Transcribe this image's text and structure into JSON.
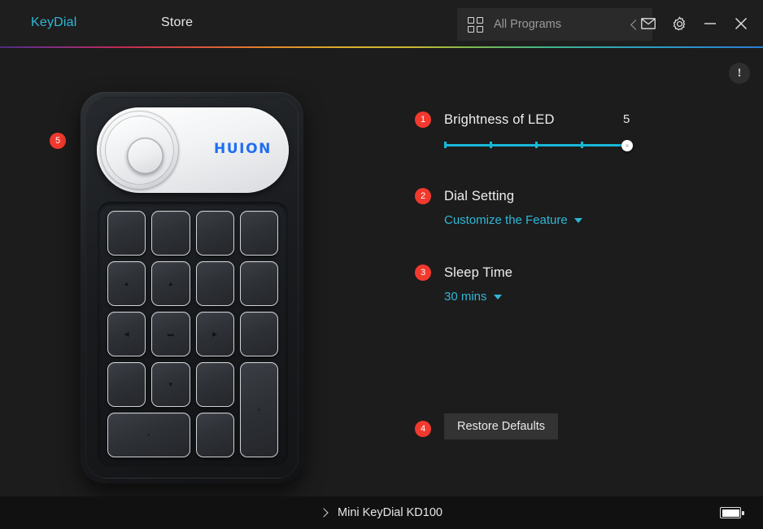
{
  "header": {
    "brand": "KeyDial",
    "store": "Store",
    "programs": {
      "label": "All Programs",
      "grid_icon": "grid-icon",
      "collapse_icon": "chevron-left-icon"
    },
    "window_controls": [
      {
        "name": "mail-icon",
        "label": "Mail"
      },
      {
        "name": "gear-icon",
        "label": "Settings"
      },
      {
        "name": "minimize-icon",
        "label": "Minimize"
      },
      {
        "name": "close-icon",
        "label": "Close"
      }
    ],
    "accent_gradient": "rainbow"
  },
  "content": {
    "alert_icon": "!",
    "device_badge": "5",
    "device": {
      "brand_logo": "HUION",
      "dial_name": "rotary-dial",
      "keys": [
        {
          "glyph": "",
          "span": ""
        },
        {
          "glyph": "",
          "span": ""
        },
        {
          "glyph": "",
          "span": ""
        },
        {
          "glyph": "",
          "span": ""
        },
        {
          "glyph": "",
          "span": ""
        },
        {
          "glyph": "▲",
          "span": ""
        },
        {
          "glyph": "",
          "span": ""
        },
        {
          "glyph": "",
          "span": ""
        },
        {
          "glyph": "◀",
          "span": ""
        },
        {
          "glyph": "▬",
          "span": ""
        },
        {
          "glyph": "▶",
          "span": ""
        },
        {
          "glyph": "",
          "span": ""
        },
        {
          "glyph": "",
          "span": ""
        },
        {
          "glyph": "▼",
          "span": ""
        },
        {
          "glyph": "",
          "span": ""
        },
        {
          "glyph": "•",
          "span": "tall"
        },
        {
          "glyph": "•",
          "span": "wide"
        },
        {
          "glyph": "",
          "span": ""
        }
      ]
    }
  },
  "settings": {
    "brightness": {
      "badge": "1",
      "title": "Brightness of LED",
      "value": "5",
      "min": 1,
      "max": 5,
      "ticks": 5
    },
    "dial": {
      "badge": "2",
      "title": "Dial Setting",
      "value": "Customize the Feature"
    },
    "sleep": {
      "badge": "3",
      "title": "Sleep Time",
      "value": "30 mins"
    },
    "restore": {
      "badge": "4",
      "label": "Restore Defaults"
    }
  },
  "footer": {
    "device_name": "Mini KeyDial KD100",
    "expand_icon": "chevron-right-icon",
    "battery_icon": "battery-full-icon"
  },
  "colors": {
    "accent": "#2fb7d6",
    "badge_red": "#f1392e",
    "slider": "#18b8d8",
    "brand_blue": "#1f6ef0",
    "background": "#1c1c1c"
  }
}
